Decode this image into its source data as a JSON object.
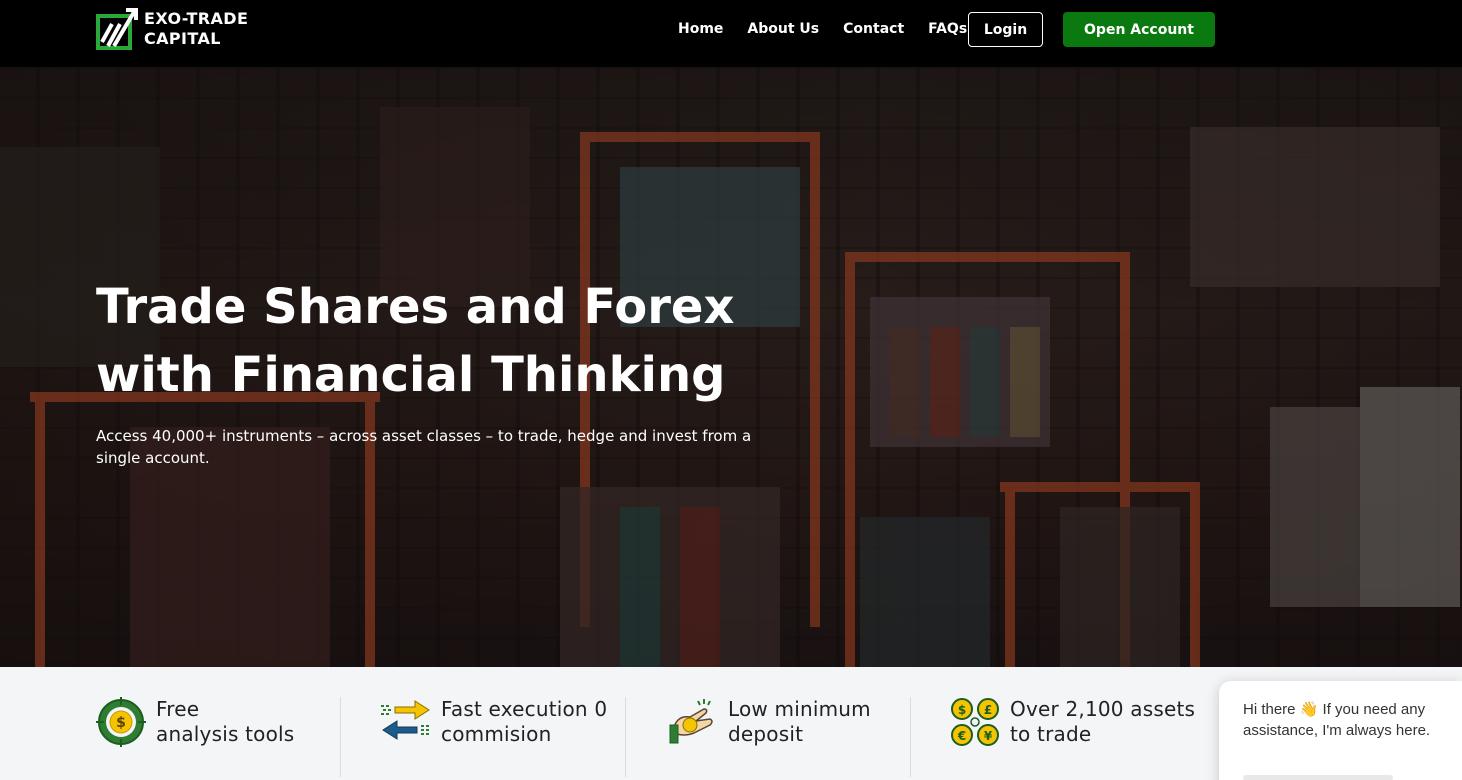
{
  "brand": {
    "line1": "EXO-TRADE",
    "line2": "CAPITAL",
    "logo_icon": "trend-arrow-logo",
    "accent": "#2aa83a"
  },
  "nav": {
    "links": [
      "Home",
      "About Us",
      "Contact",
      "FAQs"
    ],
    "login_label": "Login",
    "open_account_label": "Open Account",
    "open_account_color": "#0a7a10"
  },
  "hero": {
    "title_line1": "Trade Shares and Forex",
    "title_line2": "with Financial Thinking",
    "subtitle": "Access 40,000+ instruments – across asset classes – to trade, hedge and invest from a single account."
  },
  "features": [
    {
      "icon": "target-dollar-icon",
      "line1": "Free",
      "line2": "analysis tools"
    },
    {
      "icon": "arrows-exchange-icon",
      "line1": "Fast execution 0",
      "line2": "commision"
    },
    {
      "icon": "hand-coin-icon",
      "line1": "Low minimum",
      "line2": "deposit"
    },
    {
      "icon": "currency-coins-icon",
      "line1": "Over 2,100 assets",
      "line2": "to trade"
    }
  ],
  "chat": {
    "message": "Hi there 👋 If you need any assistance, I'm always here."
  }
}
